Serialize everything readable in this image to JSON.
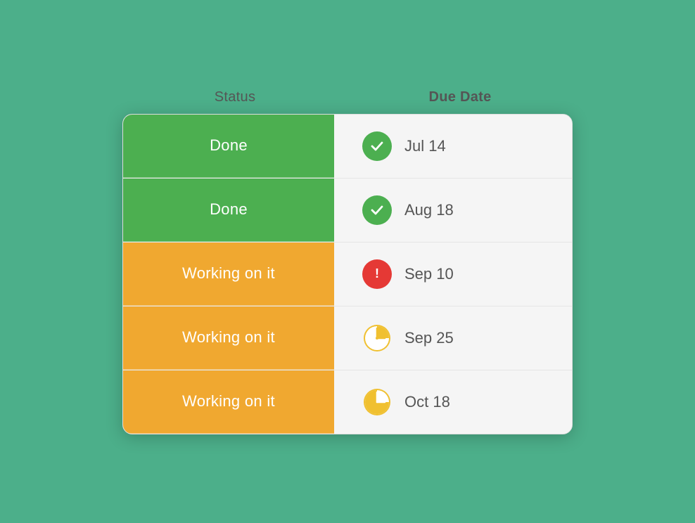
{
  "headers": {
    "status_label": "Status",
    "date_label": "Due Date"
  },
  "rows": [
    {
      "id": "row-1",
      "status": "Done",
      "status_type": "done",
      "icon_type": "check",
      "date": "Jul 14"
    },
    {
      "id": "row-2",
      "status": "Done",
      "status_type": "done",
      "icon_type": "check",
      "date": "Aug 18"
    },
    {
      "id": "row-3",
      "status": "Working on it",
      "status_type": "working",
      "icon_type": "exclaim",
      "date": "Sep 10"
    },
    {
      "id": "row-4",
      "status": "Working on it",
      "status_type": "working",
      "icon_type": "clock-quarter",
      "date": "Sep 25"
    },
    {
      "id": "row-5",
      "status": "Working on it",
      "status_type": "working",
      "icon_type": "clock-three-quarter",
      "date": "Oct 18"
    }
  ],
  "colors": {
    "done_bg": "#4caf50",
    "working_bg": "#f0a830",
    "check_circle": "#4caf50",
    "exclaim_circle": "#e53935",
    "clock_color": "#f0c030"
  }
}
